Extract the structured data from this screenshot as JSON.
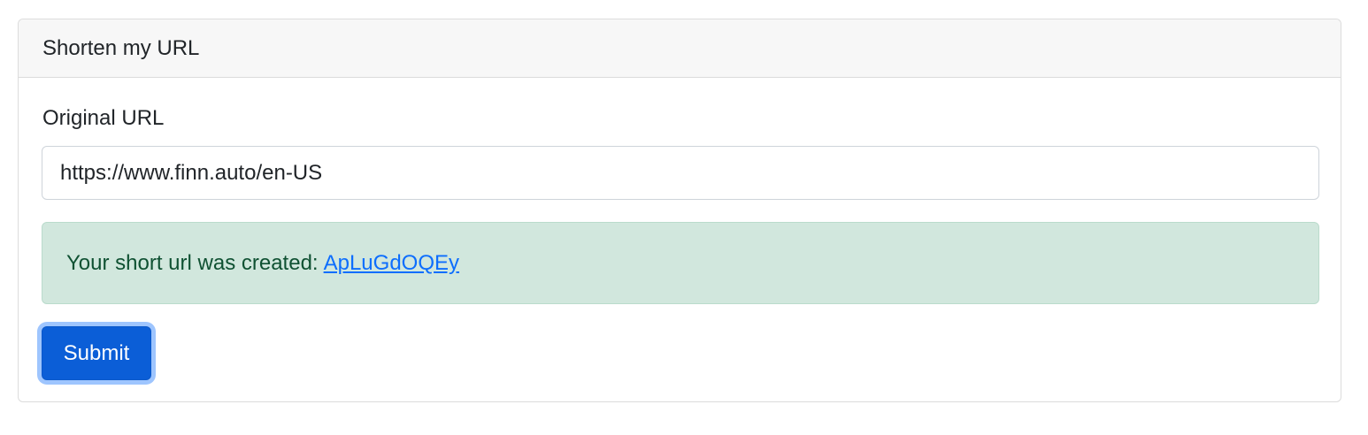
{
  "card": {
    "header": "Shorten my URL"
  },
  "form": {
    "original_url_label": "Original URL",
    "original_url_value": "https://www.finn.auto/en-US",
    "submit_label": "Submit"
  },
  "alert": {
    "message": "Your short url was created:",
    "short_link": "ApLuGdOQEy"
  },
  "colors": {
    "primary": "#0b5ed7",
    "success_bg": "#d1e7dd",
    "success_text": "#0f5132",
    "link": "#0d6efd"
  }
}
